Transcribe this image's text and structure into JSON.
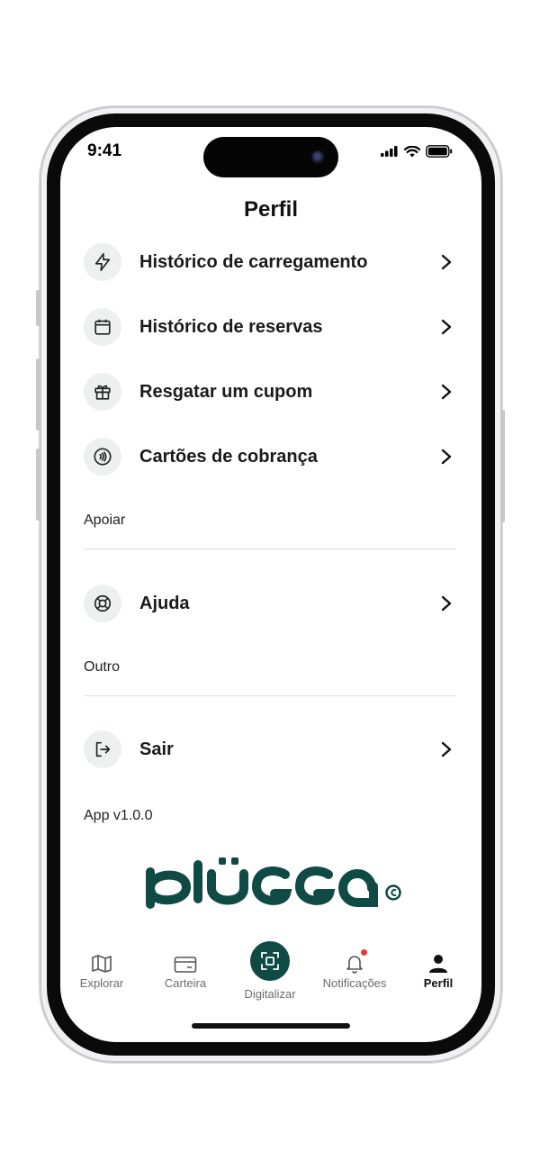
{
  "status": {
    "time": "9:41"
  },
  "page": {
    "title": "Perfil"
  },
  "menu": [
    {
      "label": "Histórico de carregamento",
      "icon": "lightning-icon"
    },
    {
      "label": "Histórico de reservas",
      "icon": "calendar-icon"
    },
    {
      "label": "Resgatar um cupom",
      "icon": "gift-icon"
    },
    {
      "label": "Cartões de cobrança",
      "icon": "contactless-card-icon"
    }
  ],
  "support": {
    "heading": "Apoiar",
    "items": [
      {
        "label": "Ajuda",
        "icon": "lifebuoy-icon"
      }
    ]
  },
  "other": {
    "heading": "Outro",
    "items": [
      {
        "label": "Sair",
        "icon": "logout-icon"
      }
    ]
  },
  "app": {
    "version": "App v1.0.0",
    "logo_text": "plügga",
    "logo_color": "#0f4a45"
  },
  "tabs": [
    {
      "label": "Explorar",
      "icon": "map-icon"
    },
    {
      "label": "Carteira",
      "icon": "wallet-icon"
    },
    {
      "label": "Digitalizar",
      "icon": "scan-icon"
    },
    {
      "label": "Notificações",
      "icon": "bell-icon",
      "badge": true
    },
    {
      "label": "Perfil",
      "icon": "user-icon",
      "active": true
    }
  ],
  "colors": {
    "accent": "#0f4a45",
    "badge": "#e53935"
  }
}
